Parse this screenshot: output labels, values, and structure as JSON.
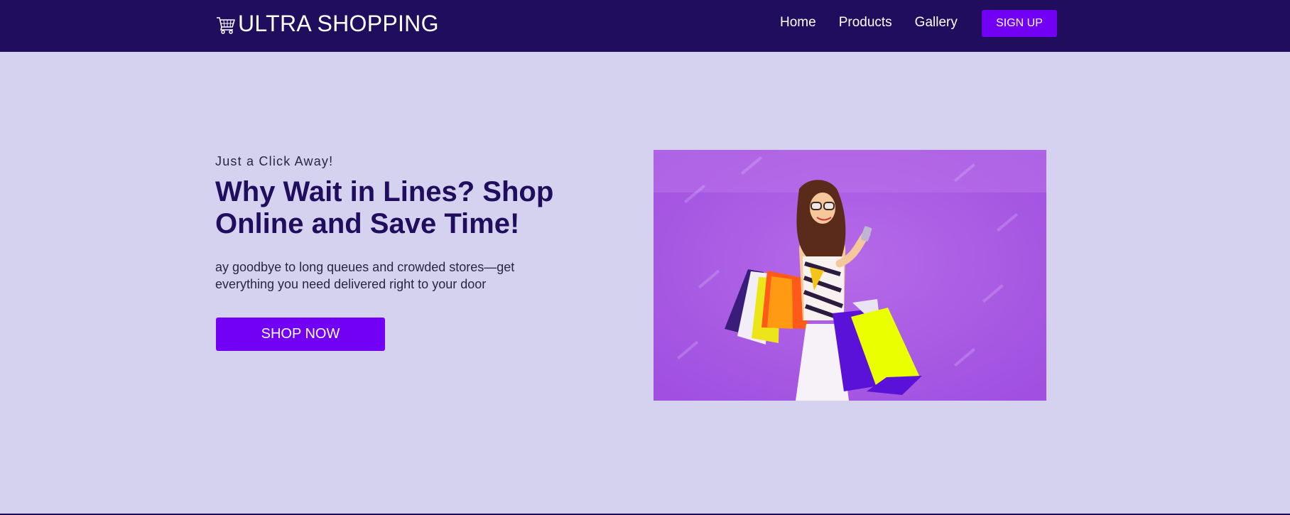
{
  "header": {
    "brand": "ULTRA SHOPPING",
    "brand_icon": "shopping-cart-icon",
    "nav": [
      "Home",
      "Products",
      "Gallery"
    ],
    "signup_label": "SIGN UP"
  },
  "hero": {
    "eyebrow": "Just a Click Away!",
    "headline": "Why Wait in Lines? Shop Online and Save Time!",
    "description": "ay goodbye to long queues and crowded stores—get everything you need delivered right to your door",
    "cta_label": "SHOP NOW"
  },
  "colors": {
    "navbar": "#210d5e",
    "background": "#d4d2ef",
    "accent": "#7100f5",
    "headline": "#210d5e"
  }
}
